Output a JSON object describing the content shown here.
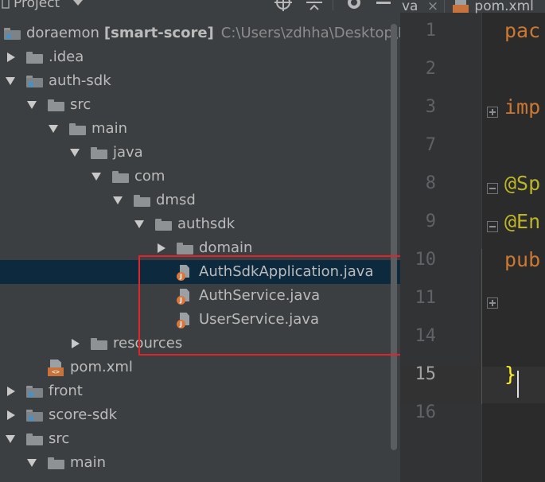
{
  "panel": {
    "title": "Project",
    "icons": [
      "target-icon",
      "collapse-all-icon",
      "gear-icon",
      "minimize-icon"
    ]
  },
  "tree": [
    {
      "label": "doraemon",
      "bold_suffix": "[smart-score]",
      "path": "C:\\Users\\zdhha\\Desktop\\DT",
      "icon": "module-folder",
      "arrow": "none",
      "depth": 0
    },
    {
      "label": ".idea",
      "icon": "folder",
      "arrow": "right",
      "depth": 0
    },
    {
      "label": "auth-sdk",
      "icon": "module-folder",
      "arrow": "down",
      "depth": 0
    },
    {
      "label": "src",
      "icon": "folder",
      "arrow": "down",
      "depth": 1
    },
    {
      "label": "main",
      "icon": "folder",
      "arrow": "down",
      "depth": 2
    },
    {
      "label": "java",
      "icon": "folder",
      "arrow": "down",
      "depth": 3
    },
    {
      "label": "com",
      "icon": "folder",
      "arrow": "down",
      "depth": 4
    },
    {
      "label": "dmsd",
      "icon": "folder",
      "arrow": "down",
      "depth": 5
    },
    {
      "label": "authsdk",
      "icon": "folder",
      "arrow": "down",
      "depth": 6
    },
    {
      "label": "domain",
      "icon": "folder",
      "arrow": "right",
      "depth": 7
    },
    {
      "label": "AuthSdkApplication.java",
      "icon": "java",
      "arrow": "none",
      "depth": 7,
      "selected": true
    },
    {
      "label": "AuthService.java",
      "icon": "java",
      "arrow": "none",
      "depth": 7
    },
    {
      "label": "UserService.java",
      "icon": "java",
      "arrow": "none",
      "depth": 7
    },
    {
      "label": "resources",
      "icon": "folder",
      "arrow": "right",
      "depth": 3
    },
    {
      "label": "pom.xml",
      "icon": "xml",
      "arrow": "none",
      "depth": 1
    },
    {
      "label": "front",
      "icon": "module-folder",
      "arrow": "right",
      "depth": 0
    },
    {
      "label": "score-sdk",
      "icon": "module-folder",
      "arrow": "right",
      "depth": 0
    },
    {
      "label": "src",
      "icon": "folder",
      "arrow": "down",
      "depth": 0
    },
    {
      "label": "main",
      "icon": "folder",
      "arrow": "down",
      "depth": 1
    }
  ],
  "editor": {
    "tabs": [
      {
        "label": "va",
        "close": "×"
      },
      {
        "label": "pom.xml"
      }
    ],
    "lines": [
      {
        "num": "1",
        "text": "pac",
        "cls": "kw"
      },
      {
        "num": "2",
        "text": ""
      },
      {
        "num": "3",
        "text": "imp",
        "cls": "kw",
        "fold": "plus"
      },
      {
        "num": "7",
        "text": ""
      },
      {
        "num": "8",
        "text": "@Sp",
        "cls": "ann",
        "fold": "minus"
      },
      {
        "num": "9",
        "text": "@En",
        "cls": "ann",
        "fold": "minus"
      },
      {
        "num": "10",
        "text": "pub",
        "cls": "kw"
      },
      {
        "num": "11",
        "text": "",
        "fold": "plus"
      },
      {
        "num": "14",
        "text": ""
      },
      {
        "num": "15",
        "text": "}",
        "cls": "brace",
        "current": true
      },
      {
        "num": "16",
        "text": ""
      }
    ]
  },
  "colors": {
    "panel_bg": "#3c3f41",
    "editor_bg": "#2b2b2b",
    "selection": "#0d293e",
    "highlight_box": "#e0252a",
    "keyword": "#cc7832",
    "annotation": "#bbb529"
  }
}
